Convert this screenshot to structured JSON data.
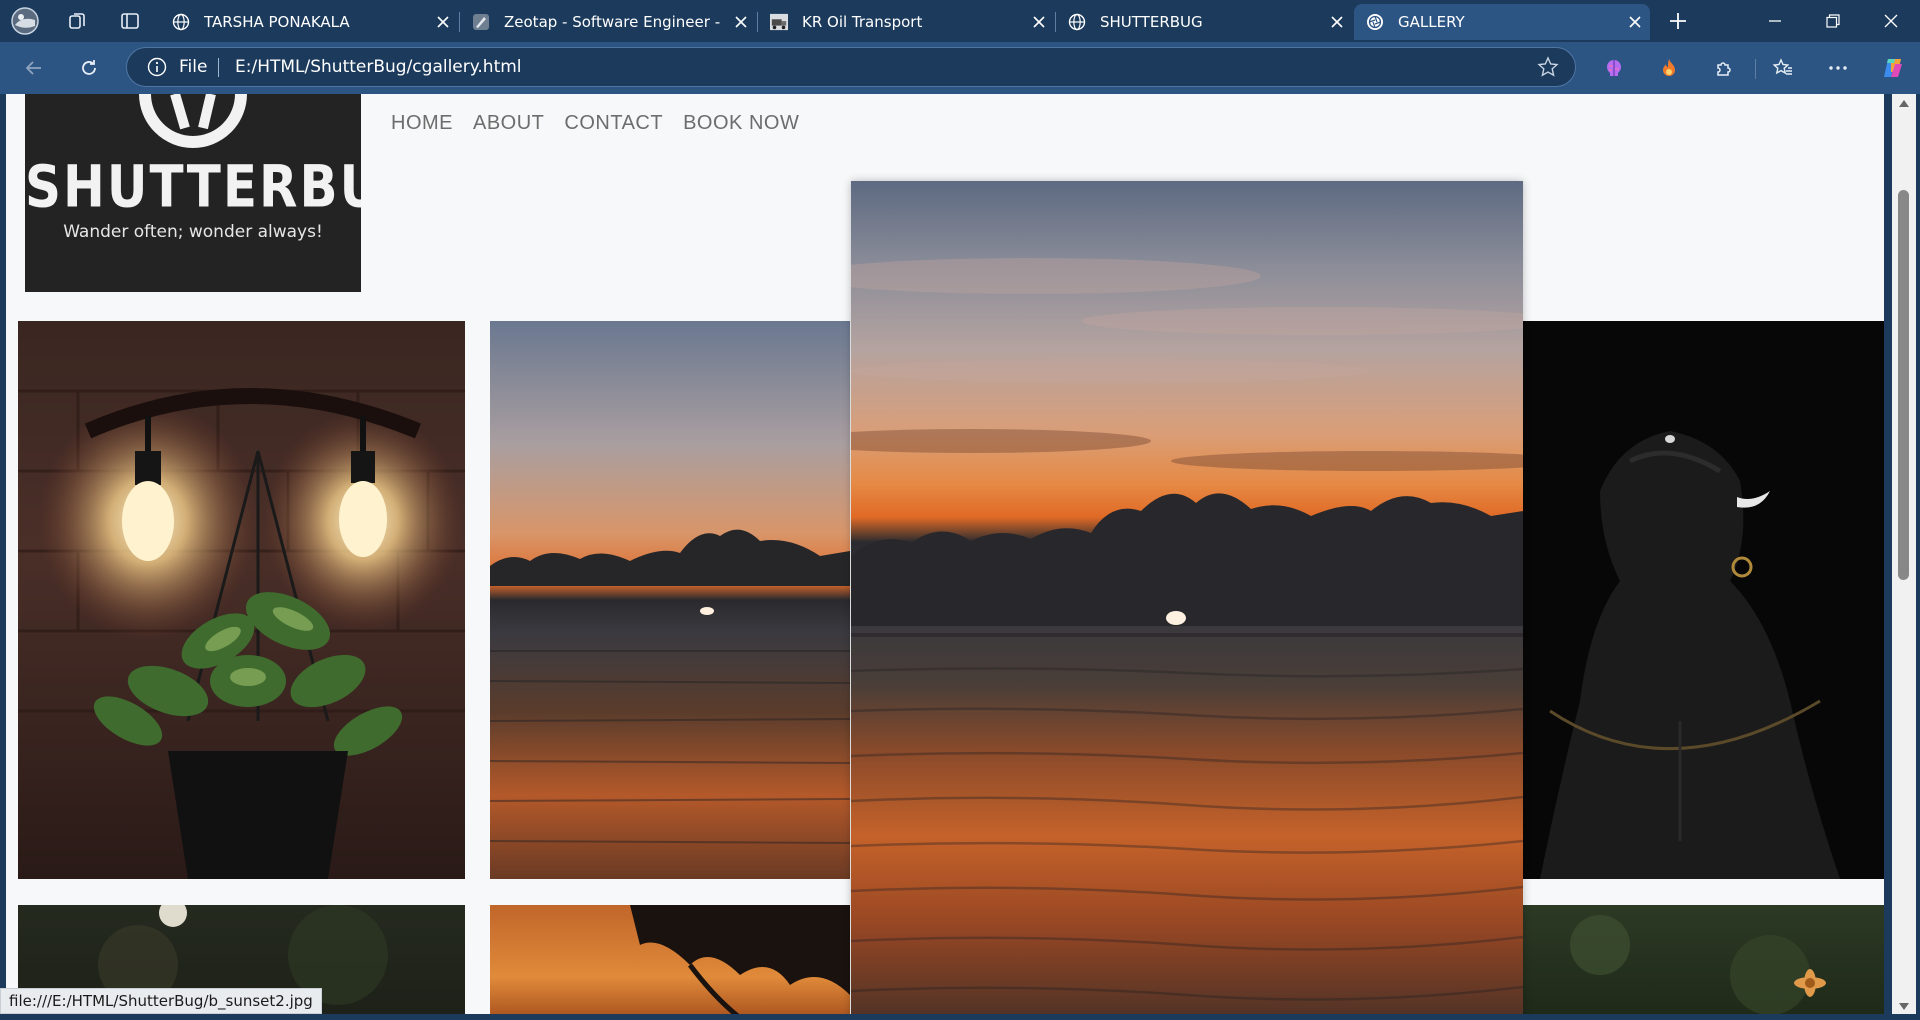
{
  "browser": {
    "tabs": [
      {
        "title": "TARSHA PONAKALA",
        "icon": "globe-icon",
        "active": false
      },
      {
        "title": "Zeotap - Software Engineer - Inte",
        "icon": "pen-icon",
        "active": false
      },
      {
        "title": "KR Oil Transport",
        "icon": "truck-favicon",
        "active": false
      },
      {
        "title": "SHUTTERBUG",
        "icon": "globe-icon",
        "active": false
      },
      {
        "title": "GALLERY",
        "icon": "aperture-icon",
        "active": true
      }
    ],
    "address": {
      "scheme_label": "File",
      "url": "E:/HTML/ShutterBug/cgallery.html"
    },
    "status_url": "file:///E:/HTML/ShutterBug/b_sunset2.jpg"
  },
  "page": {
    "logo": {
      "wordmark": "SHUTTERBUG",
      "tagline": "Wander often; wonder always!"
    },
    "nav": [
      "HOME",
      "ABOUT",
      "CONTACT",
      "BOOK NOW"
    ],
    "gallery": [
      {
        "name": "lamps-plant-photo"
      },
      {
        "name": "sunset-sea-photo"
      },
      {
        "name": "statue-photo"
      },
      {
        "name": "bokeh-photo"
      },
      {
        "name": "sunset-tree-photo"
      },
      {
        "name": "flowers-photo"
      },
      {
        "name": "sunset-sea-enlarged-photo"
      }
    ]
  },
  "colors": {
    "chrome": "#1b3a5c",
    "chrome_active": "#2d5584",
    "page_bg": "#f7f8f9",
    "logo_bg": "#232323",
    "nav_text": "#6d6d6d"
  }
}
